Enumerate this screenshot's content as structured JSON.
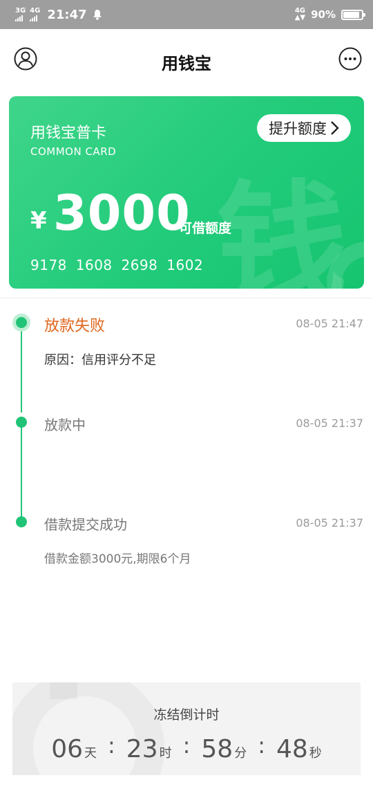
{
  "status_bar": {
    "sim1": "3G",
    "sim2": "4G",
    "time": "21:47",
    "network": "4G",
    "battery": "90%",
    "battery_level": 0.9
  },
  "header": {
    "title": "用钱宝"
  },
  "card": {
    "name": "用钱宝普卡",
    "subtitle": "COMMON CARD",
    "raise_button": "提升额度",
    "currency": "¥",
    "amount": "3000",
    "amount_label": "可借额度",
    "card_number": "9178 1608 2698 1602",
    "watermark": "钱"
  },
  "timeline": [
    {
      "title": "放款失败",
      "time": "08-05 21:47",
      "desc": "原因：信用评分不足"
    },
    {
      "title": "放款中",
      "time": "08-05 21:37",
      "desc": ""
    },
    {
      "title": "借款提交成功",
      "time": "08-05 21:37",
      "desc": "借款金额3000元,期限6个月"
    }
  ],
  "countdown": {
    "label": "冻结倒计时",
    "days": "06",
    "days_unit": "天",
    "hours": "23",
    "hours_unit": "时",
    "minutes": "58",
    "minutes_unit": "分",
    "seconds": "48",
    "seconds_unit": "秒",
    "sep": ":"
  },
  "colors": {
    "accent": "#21c476",
    "fail": "#e0661d"
  }
}
